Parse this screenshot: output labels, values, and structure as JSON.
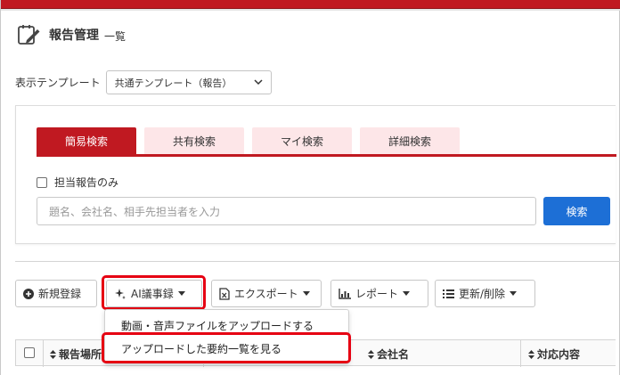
{
  "header": {
    "title": "報告管理",
    "subtitle": "一覧",
    "icon": "edit-document-icon"
  },
  "template": {
    "label": "表示テンプレート",
    "selected": "共通テンプレート（報告）"
  },
  "search": {
    "tabs": [
      {
        "label": "簡易検索",
        "active": true
      },
      {
        "label": "共有検索",
        "active": false
      },
      {
        "label": "マイ検索",
        "active": false
      },
      {
        "label": "詳細検索",
        "active": false
      }
    ],
    "only_mine_label": "担当報告のみ",
    "placeholder": "題名、会社名、相手先担当者を入力",
    "button_label": "検索"
  },
  "toolbar": {
    "new_label": "新規登録",
    "ai_label": "AI議事録",
    "export_label": "エクスポート",
    "report_label": "レポート",
    "update_label": "更新/削除"
  },
  "ai_menu": {
    "items": [
      "動画・音声ファイルをアップロードする",
      "アップロードした要約一覧を見る"
    ]
  },
  "table": {
    "columns": [
      "報告場所",
      "会社名",
      "対応内容"
    ]
  },
  "colors": {
    "accent": "#c01921",
    "tab_inactive": "#fde6e8",
    "primary_button": "#1d6fd6",
    "highlight": "#e60012"
  }
}
